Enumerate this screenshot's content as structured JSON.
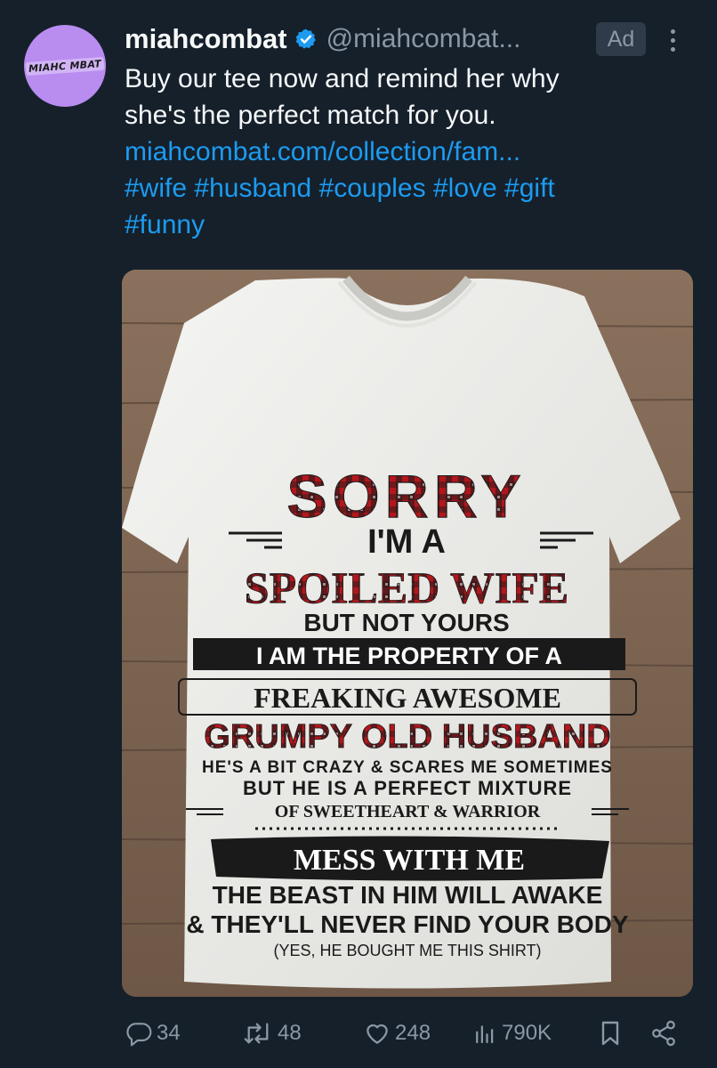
{
  "author": {
    "avatar_text": "MIAHC MBAT",
    "display_name": "miahcombat",
    "handle": "@miahcombat...",
    "verified": true
  },
  "ad_label": "Ad",
  "tweet": {
    "line1": "Buy our tee now and remind her why",
    "line2": "she's the perfect match for you.",
    "link": "miahcombat.com/collection/fam...",
    "hashtags": [
      "#wife",
      "#husband",
      "#couples",
      "#love",
      "#gift",
      "#funny"
    ]
  },
  "shirt": {
    "line1": "SORRY",
    "line2": "I'M A",
    "line3": "SPOILED WIFE",
    "line4": "BUT NOT YOURS",
    "line5": "I AM THE PROPERTY OF A",
    "line6": "FREAKING AWESOME",
    "line7": "GRUMPY OLD HUSBAND",
    "line8": "HE'S A BIT CRAZY & SCARES ME SOMETIMES",
    "line9": "BUT HE IS A PERFECT MIXTURE",
    "line10": "OF SWEETHEART & WARRIOR",
    "line11": "MESS WITH ME",
    "line12": "THE BEAST IN HIM WILL AWAKE",
    "line13": "& THEY'LL NEVER FIND YOUR BODY",
    "line14": "(YES, HE BOUGHT ME THIS SHIRT)"
  },
  "actions": {
    "replies": "34",
    "reposts": "48",
    "likes": "248",
    "views": "790K"
  },
  "colors": {
    "background": "#15202b",
    "accent": "#1d9bf0",
    "muted": "#8b98a5",
    "avatar": "#b98cf0",
    "shirt_red": "#b3171c"
  },
  "icons": [
    "verified-badge-icon",
    "more-icon",
    "reply-icon",
    "repost-icon",
    "like-icon",
    "views-icon",
    "bookmark-icon",
    "share-icon"
  ]
}
